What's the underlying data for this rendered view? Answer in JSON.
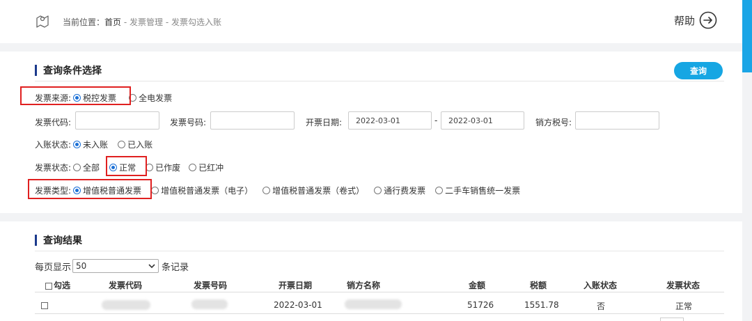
{
  "breadcrumb": {
    "prefix": "当前位置：",
    "home": "首页",
    "sep": "-",
    "items": [
      "发票管理",
      "发票勾选入账"
    ]
  },
  "help_label": "帮助",
  "search": {
    "title": "查询条件选择",
    "query_button": "查询",
    "source": {
      "label": "发票来源:",
      "options": [
        {
          "label": "税控发票",
          "checked": true
        },
        {
          "label": "全电发票",
          "checked": false
        }
      ]
    },
    "fields": {
      "code_label": "发票代码:",
      "code_value": "",
      "number_label": "发票号码:",
      "number_value": "",
      "date_label": "开票日期:",
      "date_from": "2022-03-01",
      "date_sep": "-",
      "date_to": "2022-03-01",
      "taxid_label": "销方税号:",
      "taxid_value": ""
    },
    "entry_status": {
      "label": "入账状态:",
      "options": [
        {
          "label": "未入账",
          "checked": true
        },
        {
          "label": "已入账",
          "checked": false
        }
      ]
    },
    "invoice_status": {
      "label": "发票状态:",
      "options": [
        {
          "label": "全部",
          "checked": false
        },
        {
          "label": "正常",
          "checked": true
        },
        {
          "label": "已作废",
          "checked": false
        },
        {
          "label": "已红冲",
          "checked": false
        }
      ]
    },
    "invoice_type": {
      "label": "发票类型:",
      "options": [
        {
          "label": "增值税普通发票",
          "checked": true
        },
        {
          "label": "增值税普通发票（电子）",
          "checked": false
        },
        {
          "label": "增值税普通发票（卷式）",
          "checked": false
        },
        {
          "label": "通行费发票",
          "checked": false
        },
        {
          "label": "二手车销售统一发票",
          "checked": false
        }
      ]
    }
  },
  "results": {
    "title": "查询结果",
    "page_size_prefix": "每页显示",
    "page_size_value": "50",
    "page_size_suffix": "条记录",
    "columns": [
      "勾选",
      "发票代码",
      "发票号码",
      "开票日期",
      "销方名称",
      "金额",
      "税额",
      "入账状态",
      "发票状态"
    ],
    "rows": [
      {
        "checked": false,
        "date": "2022-03-01",
        "amount": "51726",
        "tax": "1551.78",
        "entry": "否",
        "status": "正常"
      }
    ]
  },
  "colors": {
    "accent": "#16a6e3",
    "title_bar": "#1b3a8c",
    "highlight": "#e02020",
    "radio_on": "#1a6fd6"
  }
}
